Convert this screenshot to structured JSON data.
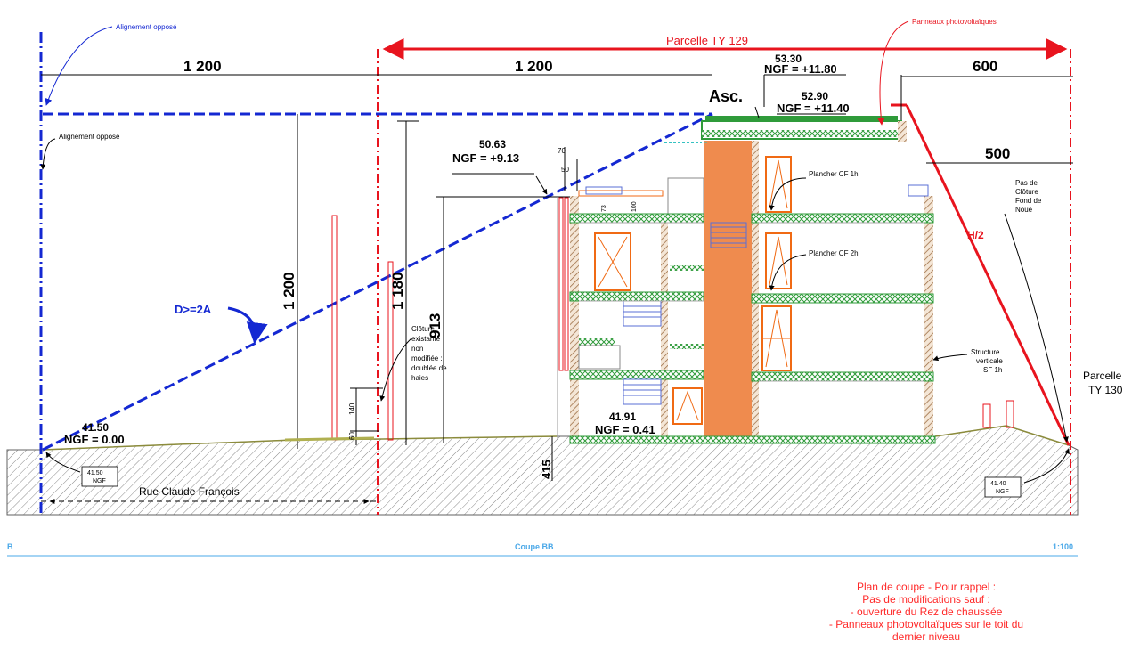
{
  "drawing": {
    "title": "Coupe BB",
    "section_mark": "B",
    "scale": "1:100",
    "colors": {
      "boundary_red": "#e8141e",
      "opposite_alignment_blue": "#1428d2",
      "ground_hatch": "#7a7a7a",
      "slab_green": "#2f9b3a",
      "stair_core_orange": "#ef8b4e",
      "window_orange": "#f06a14",
      "title_blue": "#4aa8e8"
    }
  },
  "labels": {
    "alignement_top": "Alignement opposé",
    "alignement_left": "Alignement opposé",
    "parcelle_ty129": "Parcelle TY 129",
    "panneaux": "Panneaux photovoltaïques",
    "asc": "Asc.",
    "d_rule": "D>=2A",
    "h_half": "H/2",
    "plancher_1h": "Plancher CF 1h",
    "plancher_2h": "Plancher CF 2h",
    "structure": [
      "Structure",
      "verticale",
      "SF 1h"
    ],
    "pas_de_cloture": [
      "Pas de",
      "Clôture",
      "Fond de",
      "Noue"
    ],
    "cloture": [
      "Clôture",
      "existante",
      "non",
      "modifiée :",
      "doublée de",
      "haies"
    ],
    "parcelle_ty130": [
      "Parcelle",
      "TY 130"
    ],
    "rue": "Rue Claude François"
  },
  "dimensions": {
    "top_left_width": "1 200",
    "top_mid_width": "1 200",
    "top_right_width": "600",
    "setback_right": "500",
    "vertical_left": "1 200",
    "vertical_mid": "1 180",
    "vertical_913": "913",
    "d140": "140",
    "d60": "60",
    "d415": "415",
    "d70": "70",
    "d50": "50",
    "d73": "73",
    "d100": "100"
  },
  "levels": {
    "roof_top_value": "53.30",
    "roof_top_ngf": "NGF = +11.80",
    "roof_value": "52.90",
    "roof_ngf": "NGF = +11.40",
    "left_roof_value": "50.63",
    "left_roof_ngf": "NGF = +9.13",
    "ground_value": "41.91",
    "ground_ngf": "NGF = 0.41",
    "street_value": "41.50",
    "street_ngf": "NGF = 0.00",
    "street_box_value": "41.50",
    "street_box_ngf": "NGF",
    "right_box_value": "41.40",
    "right_box_ngf": "NGF"
  },
  "note": {
    "lines": [
      "Plan de coupe - Pour rappel :",
      "Pas de modifications sauf :",
      "- ouverture du Rez de chaussée",
      "- Panneaux photovoltaïques sur le toit du",
      "dernier niveau"
    ]
  }
}
